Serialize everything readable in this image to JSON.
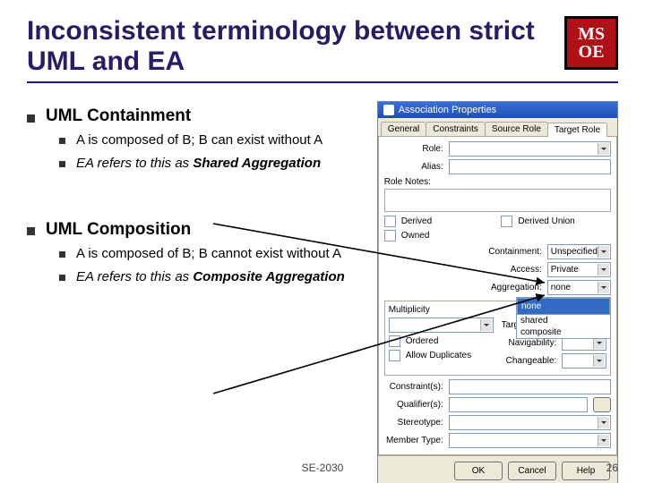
{
  "title": "Inconsistent terminology between strict UML and EA",
  "logo": {
    "line1": "MS",
    "line2": "OE"
  },
  "sections": [
    {
      "heading": "UML Containment",
      "items": [
        {
          "text": "A is composed of B; B can exist without A",
          "italic": false
        },
        {
          "text_prefix": "EA refers to this as ",
          "bold": "Shared Aggregation",
          "italic": true
        }
      ]
    },
    {
      "heading": "UML Composition",
      "items": [
        {
          "text": "A is composed of B; B cannot exist without A",
          "italic": false
        },
        {
          "text_prefix": "EA refers to this as ",
          "bold": "Composite Aggregation",
          "italic": true
        }
      ]
    }
  ],
  "dialog": {
    "title": "Association Properties",
    "tabs": [
      "General",
      "Constraints",
      "Source Role",
      "Target Role"
    ],
    "active_tab": 3,
    "fields": {
      "role": "Role:",
      "alias": "Alias:",
      "role_notes": "Role Notes:",
      "derived": "Derived",
      "owned": "Owned",
      "derived_union": "Derived Union",
      "containment": "Containment:",
      "access": "Access:",
      "aggregation": "Aggregation:",
      "target_scope": "Target Scope:",
      "navigability": "Navigability:",
      "changeable": "Changeable:",
      "multiplicity": "Multiplicity",
      "ordered": "Ordered",
      "allow_dupes": "Allow Duplicates",
      "constraints": "Constraint(s):",
      "qualifiers": "Qualifier(s):",
      "stereotype": "Stereotype:",
      "member_type": "Member Type:"
    },
    "values": {
      "containment": "Unspecified",
      "access": "Private",
      "aggregation": "none",
      "agg_options": [
        "none",
        "shared",
        "composite"
      ]
    },
    "buttons": {
      "ok": "OK",
      "cancel": "Cancel",
      "help": "Help"
    }
  },
  "footer": "SE-2030",
  "page": "26"
}
